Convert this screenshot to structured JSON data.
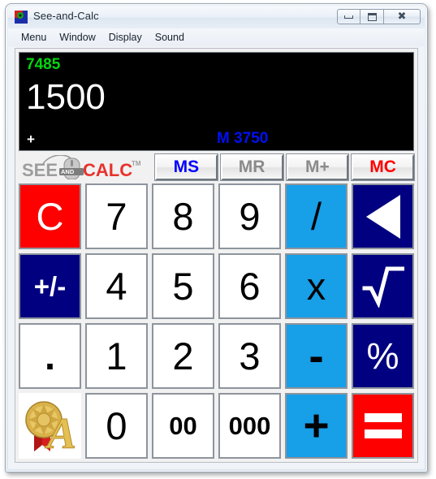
{
  "window": {
    "title": "See-and-Calc",
    "icon": "app-icon",
    "controls": {
      "minimize": "minimize",
      "maximize": "maximize",
      "close": "close"
    }
  },
  "menubar": {
    "items": [
      {
        "label": "Menu"
      },
      {
        "label": "Window"
      },
      {
        "label": "Display"
      },
      {
        "label": "Sound"
      }
    ]
  },
  "display": {
    "previous_value": "7485",
    "current_value": "1500",
    "pending_operator": "+",
    "memory_indicator": "M 3750",
    "colors": {
      "background": "#000000",
      "previous": "#00d80d",
      "current": "#ffffff",
      "operator": "#ffffff",
      "memory": "#0010f4"
    }
  },
  "logo": {
    "part1": "SEE",
    "part2": "AND",
    "part3": "CALC",
    "trademark": "TM"
  },
  "memory_buttons": [
    {
      "label": "MS",
      "style": "m-blue"
    },
    {
      "label": "MR",
      "style": "m-gray"
    },
    {
      "label": "M+",
      "style": "m-gray"
    },
    {
      "label": "MC",
      "style": "m-red"
    }
  ],
  "keypad": {
    "rows": [
      [
        {
          "name": "clear",
          "label": "C",
          "style": "red"
        },
        {
          "name": "digit-7",
          "label": "7",
          "style": "num"
        },
        {
          "name": "digit-8",
          "label": "8",
          "style": "num"
        },
        {
          "name": "digit-9",
          "label": "9",
          "style": "num"
        },
        {
          "name": "divide",
          "label": "/",
          "style": "blue"
        },
        {
          "name": "backspace",
          "label": "",
          "style": "navy",
          "icon": "triangle-left-icon"
        }
      ],
      [
        {
          "name": "sign-toggle",
          "label": "+/-",
          "style": "navy txt"
        },
        {
          "name": "digit-4",
          "label": "4",
          "style": "num"
        },
        {
          "name": "digit-5",
          "label": "5",
          "style": "num"
        },
        {
          "name": "digit-6",
          "label": "6",
          "style": "num"
        },
        {
          "name": "multiply",
          "label": "x",
          "style": "blue"
        },
        {
          "name": "square-root",
          "label": "",
          "style": "navy",
          "icon": "radical-icon"
        }
      ],
      [
        {
          "name": "decimal",
          "label": ".",
          "style": "dot"
        },
        {
          "name": "digit-1",
          "label": "1",
          "style": "num"
        },
        {
          "name": "digit-2",
          "label": "2",
          "style": "num"
        },
        {
          "name": "digit-3",
          "label": "3",
          "style": "num"
        },
        {
          "name": "subtract",
          "label": "-",
          "style": "blue minus"
        },
        {
          "name": "percent",
          "label": "%",
          "style": "navy pct"
        }
      ],
      [
        {
          "name": "award-logo",
          "label": "",
          "style": "logo-key",
          "icon": "award-medal-icon"
        },
        {
          "name": "digit-0",
          "label": "0",
          "style": "num"
        },
        {
          "name": "double-zero",
          "label": "00",
          "style": "num small"
        },
        {
          "name": "triple-zero",
          "label": "000",
          "style": "num small"
        },
        {
          "name": "add",
          "label": "+",
          "style": "blue plus"
        },
        {
          "name": "equals",
          "label": "",
          "style": "red",
          "icon": "equals-icon"
        }
      ]
    ]
  },
  "colors": {
    "accent_blue": "#179fe8",
    "navy": "#000080",
    "red": "#fe0000",
    "green_display": "#00d80d",
    "memory_blue": "#0010f4"
  }
}
